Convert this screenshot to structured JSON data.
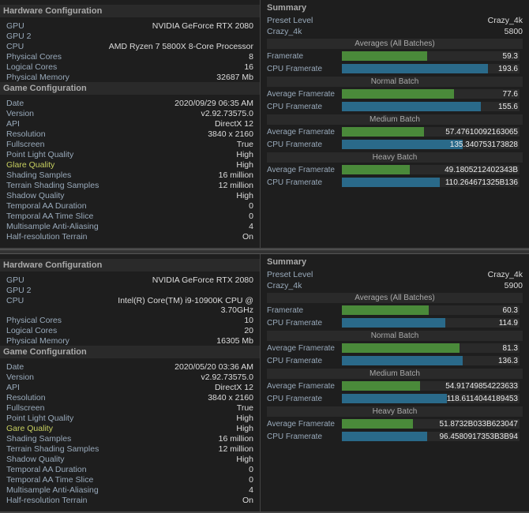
{
  "panel1": {
    "left": {
      "hardware_header": "Hardware Configuration",
      "gpu_label": "GPU",
      "gpu_val": "NVIDIA GeForce RTX 2080",
      "gpu2_label": "GPU 2",
      "gpu2_val": "",
      "cpu_label": "CPU",
      "cpu_val": "AMD Ryzen 7 5800X 8-Core Processor",
      "physical_cores_label": "Physical Cores",
      "physical_cores_val": "8",
      "logical_cores_label": "Logical Cores",
      "logical_cores_val": "16",
      "physical_memory_label": "Physical Memory",
      "physical_memory_val": "32687 Mb",
      "game_header": "Game Configuration",
      "date_label": "Date",
      "date_val": "2020/09/29 06:35 AM",
      "version_label": "Version",
      "version_val": "v2.92.73575.0",
      "api_label": "API",
      "api_val": "DirectX 12",
      "resolution_label": "Resolution",
      "resolution_val": "3840 x 2160",
      "fullscreen_label": "Fullscreen",
      "fullscreen_val": "True",
      "point_light_label": "Point Light Quality",
      "point_light_val": "High",
      "glare_label": "Glare Quality",
      "glare_val": "High",
      "shading_label": "Shading Samples",
      "shading_val": "16 million",
      "terrain_label": "Terrain Shading Samples",
      "terrain_val": "12 million",
      "shadow_label": "Shadow Quality",
      "shadow_val": "High",
      "temporal_aa_label": "Temporal AA Duration",
      "temporal_aa_val": "0",
      "temporal_slice_label": "Temporal AA Time Slice",
      "temporal_slice_val": "0",
      "multisample_label": "Multisample Anti-Aliasing",
      "multisample_val": "4",
      "half_res_label": "Half-resolution Terrain",
      "half_res_val": "On"
    },
    "right": {
      "summary_header": "Summary",
      "preset_level_label": "Preset Level",
      "preset_level_val": "Crazy_4k",
      "preset_score_val": "5800",
      "averages_label": "Averages (All Batches)",
      "framerate_label": "Framerate",
      "framerate_val": "59.3",
      "cpu_framerate_label": "CPU Framerate",
      "cpu_framerate_val": "193.6",
      "normal_batch_label": "Normal Batch",
      "avg_framerate_label": "Average Framerate",
      "avg_framerate_val": "77.6",
      "avg_cpu_label": "CPU Framerate",
      "avg_cpu_val": "155.6",
      "medium_batch_label": "Medium Batch",
      "med_avg_label": "Average Framerate",
      "med_avg_val": "57.47610092163065",
      "med_cpu_label": "CPU Framerate",
      "med_cpu_val": "135.340753173828",
      "heavy_batch_label": "Heavy Batch",
      "heavy_avg_label": "Average Framerate",
      "heavy_avg_val": "49.1805212402343B",
      "heavy_cpu_label": "CPU Framerate",
      "heavy_cpu_val": "110.264671325B136"
    }
  },
  "panel2": {
    "left": {
      "hardware_header": "Hardware Configuration",
      "gpu_label": "GPU",
      "gpu_val": "NVIDIA GeForce RTX 2080",
      "gpu2_label": "GPU 2",
      "gpu2_val": "",
      "cpu_label": "CPU",
      "cpu_val": "Intel(R) Core(TM) i9-10900K CPU @ 3.70GHz",
      "physical_cores_label": "Physical Cores",
      "physical_cores_val": "10",
      "logical_cores_label": "Logical Cores",
      "logical_cores_val": "20",
      "physical_memory_label": "Physical Memory",
      "physical_memory_val": "16305 Mb",
      "game_header": "Game Configuration",
      "date_label": "Date",
      "date_val": "2020/05/20 03:36 AM",
      "version_label": "Version",
      "version_val": "v2.92.73575.0",
      "api_label": "API",
      "api_val": "DirectX 12",
      "resolution_label": "Resolution",
      "resolution_val": "3840 x 2160",
      "fullscreen_label": "Fullscreen",
      "fullscreen_val": "True",
      "point_light_label": "Point Light Quality",
      "point_light_val": "High",
      "glare_label": "Gare Quality",
      "glare_val": "High",
      "shading_label": "Shading Samples",
      "shading_val": "16 million",
      "terrain_label": "Terrain Shading Samples",
      "terrain_val": "12 million",
      "shadow_label": "Shadow Quality",
      "shadow_val": "High",
      "temporal_aa_label": "Temporal AA Duration",
      "temporal_aa_val": "0",
      "temporal_slice_label": "Temporal AA Time Slice",
      "temporal_slice_val": "0",
      "multisample_label": "Multisample Anti-Aliasing",
      "multisample_val": "4",
      "half_res_label": "Half-resolution Terrain",
      "half_res_val": "On"
    },
    "right": {
      "summary_header": "Summary",
      "preset_level_label": "Preset Level",
      "preset_level_val": "Crazy_4k",
      "preset_score_val": "5900",
      "averages_label": "Averages (All Batches)",
      "framerate_label": "Framerate",
      "framerate_val": "60.3",
      "cpu_framerate_label": "CPU Framerate",
      "cpu_framerate_val": "114.9",
      "normal_batch_label": "Normal Batch",
      "avg_framerate_label": "Average Framerate",
      "avg_framerate_val": "81.3",
      "avg_cpu_label": "CPU Framerate",
      "avg_cpu_val": "136.3",
      "medium_batch_label": "Medium Batch",
      "med_avg_label": "Average Framerate",
      "med_avg_val": "54.91749854223633",
      "med_cpu_label": "CPU Framerate",
      "med_cpu_val": "118.6114044189453",
      "heavy_batch_label": "Heavy Batch",
      "heavy_avg_label": "Average Framerate",
      "heavy_avg_val": "51.8732B033B623047",
      "heavy_cpu_label": "CPU Framerate",
      "heavy_cpu_val": "96.4580917353B3B94"
    }
  },
  "colors": {
    "bar_green": "#5a9a3a",
    "bar_blue": "#2a7a9a",
    "bar_green_light": "#6aaa4a",
    "bar_blue_light": "#3a8aaa"
  }
}
